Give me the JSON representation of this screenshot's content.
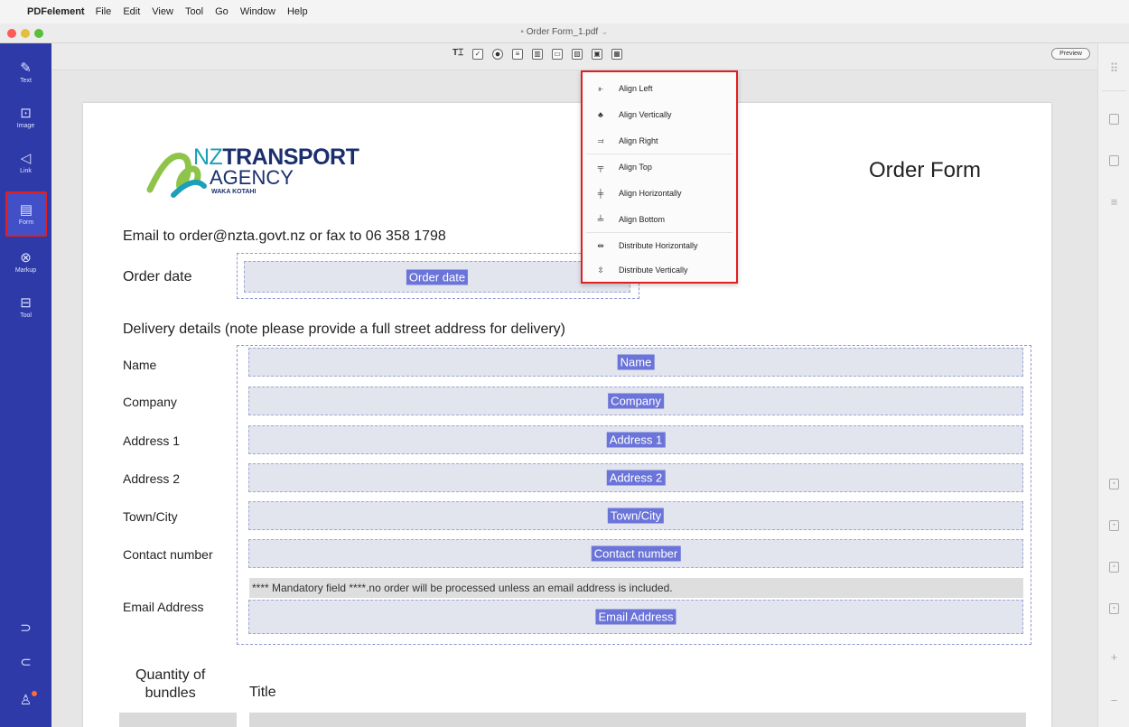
{
  "menubar": {
    "apple": "",
    "app_name": "PDFelement",
    "items": [
      "File",
      "Edit",
      "View",
      "Tool",
      "Go",
      "Window",
      "Help"
    ]
  },
  "window": {
    "title": "Order Form_1.pdf",
    "traffic_colors": [
      "#fc5b57",
      "#e5bf3c",
      "#57c038"
    ]
  },
  "sidebar": {
    "items": [
      {
        "label": "Text",
        "icon": "pen-icon",
        "glyph": "✎"
      },
      {
        "label": "Image",
        "icon": "image-icon",
        "glyph": "⊡"
      },
      {
        "label": "Link",
        "icon": "link-icon",
        "glyph": "◁"
      },
      {
        "label": "Form",
        "icon": "form-icon",
        "glyph": "▤",
        "active": true
      },
      {
        "label": "Markup",
        "icon": "markup-icon",
        "glyph": "⊗"
      },
      {
        "label": "Tool",
        "icon": "toolbox-icon",
        "glyph": "⊟"
      }
    ],
    "bottom": {
      "redo": "⊃",
      "undo": "⊂",
      "account": "♙"
    },
    "accent": "#2d3aa8"
  },
  "toolbar": {
    "tools": [
      {
        "name": "text-field-tool-icon",
        "glyph": "T⌶",
        "cls": "txt"
      },
      {
        "name": "checkbox-tool-icon",
        "glyph": "✓",
        "cls": ""
      },
      {
        "name": "radio-tool-icon",
        "glyph": "",
        "cls": "radio"
      },
      {
        "name": "combobox-tool-icon",
        "glyph": "≡",
        "cls": ""
      },
      {
        "name": "listbox-tool-icon",
        "glyph": "▥",
        "cls": ""
      },
      {
        "name": "button-tool-icon",
        "glyph": "▭",
        "cls": ""
      },
      {
        "name": "image-field-tool-icon",
        "glyph": "▨",
        "cls": ""
      },
      {
        "name": "date-field-tool-icon",
        "glyph": "▣",
        "cls": ""
      },
      {
        "name": "align-tool-icon",
        "glyph": "▦",
        "cls": ""
      }
    ],
    "preview": "Preview"
  },
  "document": {
    "logo": {
      "nz": "NZ",
      "transport": "TRANSPORT",
      "agency": "AGENCY",
      "waka": "WAKA KOTAHI"
    },
    "title": "Order Form",
    "email_line": "Email to order@nzta.govt.nz or fax to 06 358 1798",
    "order_date_label": "Order date",
    "order_date_field": "Order date",
    "delivery_heading": "Delivery details (note please provide a full street address for delivery)",
    "rows": [
      {
        "label": "Name",
        "field": "Name"
      },
      {
        "label": "Company",
        "field": "Company"
      },
      {
        "label": "Address 1",
        "field": "Address 1"
      },
      {
        "label": "Address 2",
        "field": "Address 2"
      },
      {
        "label": "Town/City",
        "field": "Town/City"
      },
      {
        "label": "Contact number",
        "field": "Contact number"
      }
    ],
    "email_label": "Email Address",
    "email_field": "Email Address",
    "mandatory_note": "**** Mandatory field ****.no order will be processed unless an email address is included.",
    "qty_line1": "Quantity of",
    "qty_line2": "bundles",
    "title_col": "Title"
  },
  "align_menu": {
    "items": [
      {
        "label": "Align Left",
        "icon": "align-left-icon",
        "glyph": "⫦"
      },
      {
        "label": "Align Vertically",
        "icon": "align-vertical-icon",
        "glyph": "♣"
      },
      {
        "label": "Align Right",
        "icon": "align-right-icon",
        "glyph": "⫤"
      },
      {
        "label": "Align Top",
        "icon": "align-top-icon",
        "glyph": "╤"
      },
      {
        "label": "Align Horizontally",
        "icon": "align-horizontal-icon",
        "glyph": "╪"
      },
      {
        "label": "Align Bottom",
        "icon": "align-bottom-icon",
        "glyph": "╧"
      },
      {
        "label": "Distribute Horizontally",
        "icon": "distribute-horizontal-icon",
        "glyph": "⇹"
      },
      {
        "label": "Distribute Vertically",
        "icon": "distribute-vertical-icon",
        "glyph": "⇳"
      }
    ],
    "highlight": "#e02020"
  }
}
